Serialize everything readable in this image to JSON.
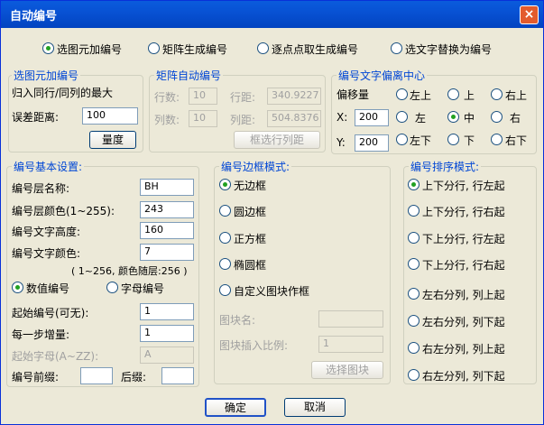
{
  "window": {
    "title": "自动编号",
    "close": "×"
  },
  "mode": {
    "options": [
      "选图元加编号",
      "矩阵生成编号",
      "逐点点取生成编号",
      "选文字替换为编号"
    ],
    "selected": 0
  },
  "pick_group": {
    "title": "选图元加编号",
    "desc": "归入同行/同列的最大",
    "tolerance_label": "误差距离:",
    "tolerance_value": "100",
    "measure_button": "量度"
  },
  "matrix_group": {
    "title": "矩阵自动编号",
    "rows_label": "行数:",
    "rows_value": "10",
    "row_spacing_label": "行距:",
    "row_spacing_value": "340.9227",
    "cols_label": "列数:",
    "cols_value": "10",
    "col_spacing_label": "列距:",
    "col_spacing_value": "504.8376",
    "select_button": "框选行列距"
  },
  "offset_group": {
    "title": "编号文字偏离中心",
    "offset_label": "偏移量",
    "x_label": "X:",
    "x_value": "200",
    "y_label": "Y:",
    "y_value": "200",
    "positions": [
      "左上",
      "上",
      "右上",
      "左",
      "中",
      "右",
      "左下",
      "下",
      "右下"
    ],
    "selected": 4
  },
  "basic_group": {
    "title": "编号基本设置:",
    "layer_name_label": "编号层名称:",
    "layer_name_value": "BH",
    "layer_color_label": "编号层颜色(1~255):",
    "layer_color_value": "243",
    "text_height_label": "编号文字高度:",
    "text_height_value": "160",
    "text_color_label": "编号文字颜色:",
    "text_color_value": "7",
    "color_note": "( 1~256, 颜色随层:256 )",
    "numeric_label": "数值编号",
    "alpha_label": "字母编号",
    "type_selected": 0,
    "start_label": "起始编号(可无):",
    "start_value": "1",
    "step_label": "每一步增量:",
    "step_value": "1",
    "start_letter_label": "起始字母(A~ZZ):",
    "start_letter_value": "A",
    "prefix_label": "编号前缀:",
    "prefix_value": "",
    "suffix_label": "后缀:",
    "suffix_value": ""
  },
  "frame_group": {
    "title": "编号边框模式:",
    "options": [
      "无边框",
      "圆边框",
      "正方框",
      "椭圆框",
      "自定义图块作框"
    ],
    "selected": 0,
    "block_name_label": "图块名:",
    "block_name_value": "",
    "block_scale_label": "图块插入比例:",
    "block_scale_value": "1",
    "select_block_button": "选择图块"
  },
  "order_group": {
    "title": "编号排序模式:",
    "options": [
      "上下分行, 行左起",
      "上下分行, 行右起",
      "下上分行, 行左起",
      "下上分行, 行右起",
      "左右分列, 列上起",
      "左右分列, 列下起",
      "右左分列, 列上起",
      "右左分列, 列下起"
    ],
    "selected": 0
  },
  "footer": {
    "ok": "确定",
    "cancel": "取消"
  }
}
